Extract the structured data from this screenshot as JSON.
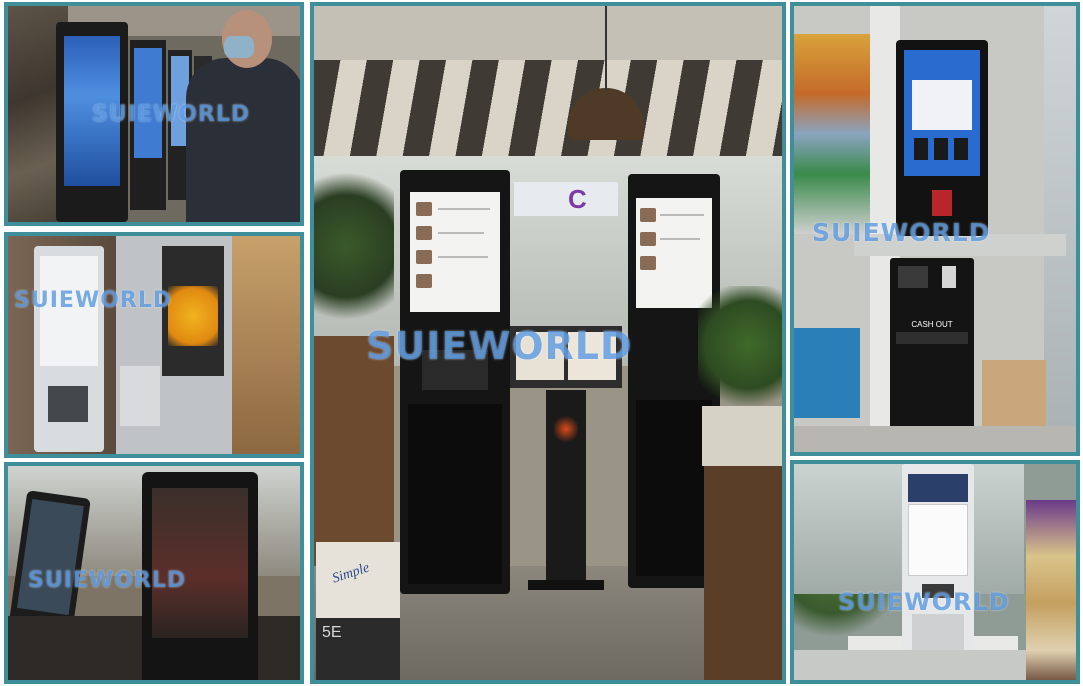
{
  "watermarks": {
    "tile_1": "SUIEWORLD",
    "tile_2": "SUIEWORLD",
    "tile_3": "SUIEWORLD",
    "center": "SUIEWORLD",
    "right_top": "SUIEWORLD",
    "right_bottom": "SUIEWORLD"
  },
  "signs": {
    "cash_out": "CASH OUT",
    "store_letter": "C",
    "box_brand": "Simple",
    "box_code": "5E"
  },
  "colors": {
    "frame": "#3f8f9a",
    "watermark": "#468cdc",
    "kiosk_body": "#141414"
  }
}
